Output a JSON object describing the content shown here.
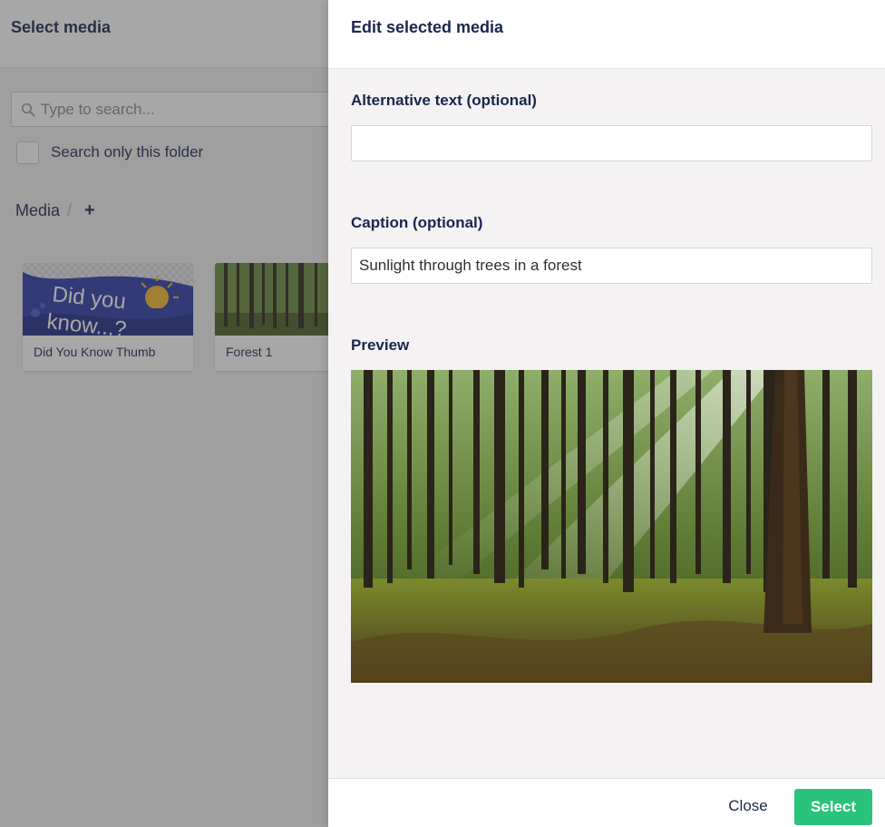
{
  "background": {
    "title": "Select media",
    "search": {
      "placeholder": "Type to search...",
      "value": ""
    },
    "search_only_folder_label": "Search only this folder",
    "breadcrumb": {
      "root": "Media",
      "separator": "/",
      "add": "+"
    },
    "media_items": [
      {
        "name": "Did You Know Thumb",
        "thumb_text_line1": "Did you",
        "thumb_text_line2": "know...?"
      },
      {
        "name": "Forest 1"
      }
    ]
  },
  "edit_panel": {
    "title": "Edit selected media",
    "alt_text": {
      "label": "Alternative text (optional)",
      "value": ""
    },
    "caption": {
      "label": "Caption (optional)",
      "value": "Sunlight through trees in a forest"
    },
    "preview_label": "Preview",
    "footer": {
      "close_label": "Close",
      "select_label": "Select"
    }
  },
  "colors": {
    "primary_text": "#1b264f",
    "select_button": "#2bc37c"
  }
}
